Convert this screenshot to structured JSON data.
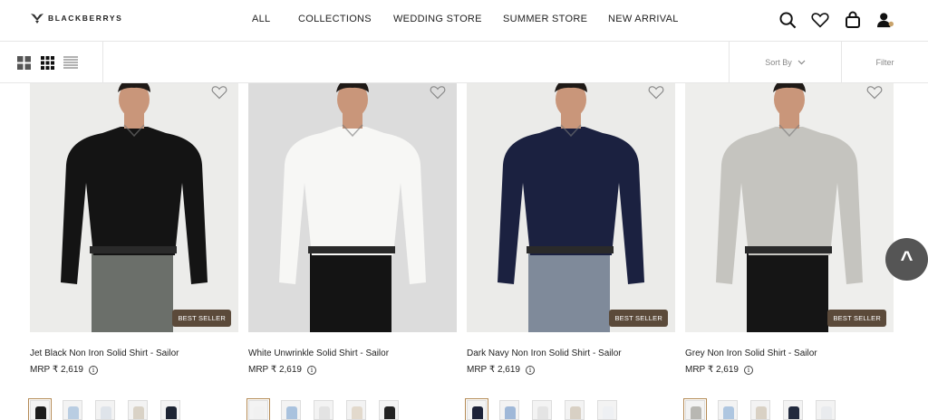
{
  "brand": {
    "name": "BLACKBERRYS"
  },
  "nav": {
    "items": [
      "ALL",
      "COLLECTIONS",
      "WEDDING STORE",
      "SUMMER STORE",
      "NEW ARRIVAL"
    ]
  },
  "toolbar": {
    "sort_label": "Sort By",
    "filter_label": "Filter"
  },
  "products": [
    {
      "name": "Jet Black Non Iron Solid Shirt - Sailor",
      "price": "MRP ₹ 2,619",
      "badge": "BEST SELLER",
      "shirt_color": "#141414",
      "pant_color": "#6b6f6a",
      "bg": "#ececea",
      "swatches": [
        "#1b1b1b",
        "#b9cde2",
        "#dfe4ea",
        "#d9d2c6",
        "#1d2433"
      ]
    },
    {
      "name": "White Unwrinkle Solid Shirt - Sailor",
      "price": "MRP ₹ 2,619",
      "badge": "",
      "shirt_color": "#f7f7f5",
      "pant_color": "#141414",
      "bg": "#dcdcdc",
      "swatches": [
        "#f1f1f1",
        "#a9c2de",
        "#e3e3e3",
        "#e2d9cc",
        "#222222"
      ]
    },
    {
      "name": "Dark Navy Non Iron Solid Shirt - Sailor",
      "price": "MRP ₹ 2,619",
      "badge": "BEST SELLER",
      "shirt_color": "#1b2140",
      "pant_color": "#7f8a9a",
      "bg": "#ebebe9",
      "swatches": [
        "#1c2238",
        "#9fb8d8",
        "#e4e4e4",
        "#d8d0c4",
        "#eef0f3"
      ]
    },
    {
      "name": "Grey Non Iron Solid Shirt - Sailor",
      "price": "MRP ₹ 2,619",
      "badge": "BEST SELLER",
      "shirt_color": "#c5c4bf",
      "pant_color": "#151515",
      "bg": "#eeeeec",
      "swatches": [
        "#b8b7b2",
        "#aec6e0",
        "#d9d1c4",
        "#222a3e",
        "#e9ebee"
      ]
    }
  ],
  "colors": {
    "badge": "#5b4a3a",
    "accent": "#b48a55"
  }
}
